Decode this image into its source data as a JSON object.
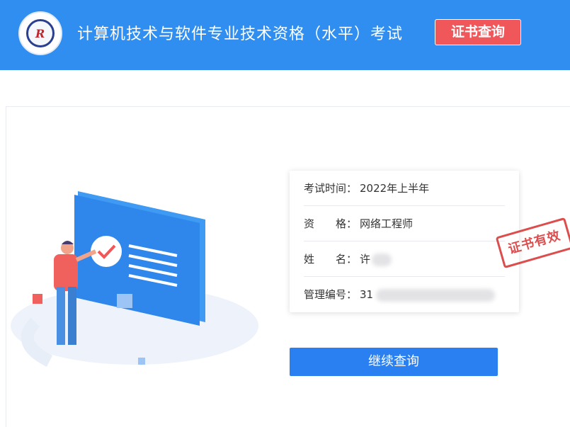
{
  "header": {
    "title": "计算机技术与软件专业技术资格（水平）考试",
    "cert_query_label": "证书查询",
    "logo_icon": "exam-authority-logo"
  },
  "result": {
    "rows": [
      {
        "label": "考试时间：",
        "value": "2022年上半年"
      },
      {
        "label": "资　　格：",
        "value": "网络工程师"
      },
      {
        "label": "姓　　名：",
        "value": "许"
      },
      {
        "label": "管理编号：",
        "value": "31"
      }
    ],
    "stamp_text": "证书有效"
  },
  "actions": {
    "continue_label": "继续查询"
  },
  "colors": {
    "header_bg": "#2f8ef0",
    "accent_red": "#f0575a",
    "primary_blue": "#2a7ff1"
  }
}
